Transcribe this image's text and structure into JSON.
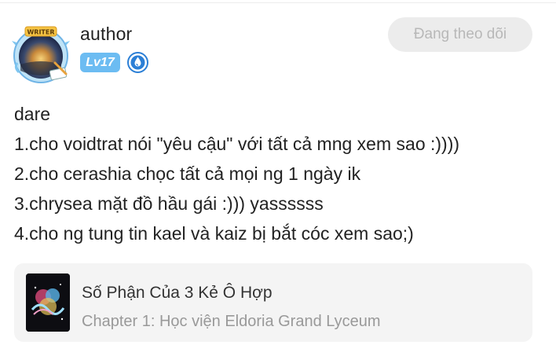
{
  "author": {
    "name": "author",
    "avatar_banner_text": "WRITER",
    "level": "Lv17",
    "role_icon": "water-drop-badge-icon"
  },
  "follow_button": {
    "label": "Đang theo dõi"
  },
  "post": {
    "lines": [
      "dare",
      "1.cho voidtrat nói \"yêu cậu\" với tất cả mng xem sao :))))",
      "2.cho cerashia chọc tất cả mọi ng 1 ngày ik",
      "3.chrysea mặt đồ hầu gái :))) yassssss",
      "4.cho ng tung tin kael và kaiz bị bắt cóc xem sao;)"
    ]
  },
  "story_card": {
    "title": "Số Phận Của 3 Kẻ Ô Hợp",
    "chapter": "Chapter 1: Học viện Eldoria Grand Lyceum"
  },
  "colors": {
    "level_badge": "#6cbcf2",
    "follow_button_bg": "#ececec",
    "follow_button_text": "#b8b8b8",
    "card_bg": "#f4f4f4",
    "chapter_text": "#999999"
  }
}
